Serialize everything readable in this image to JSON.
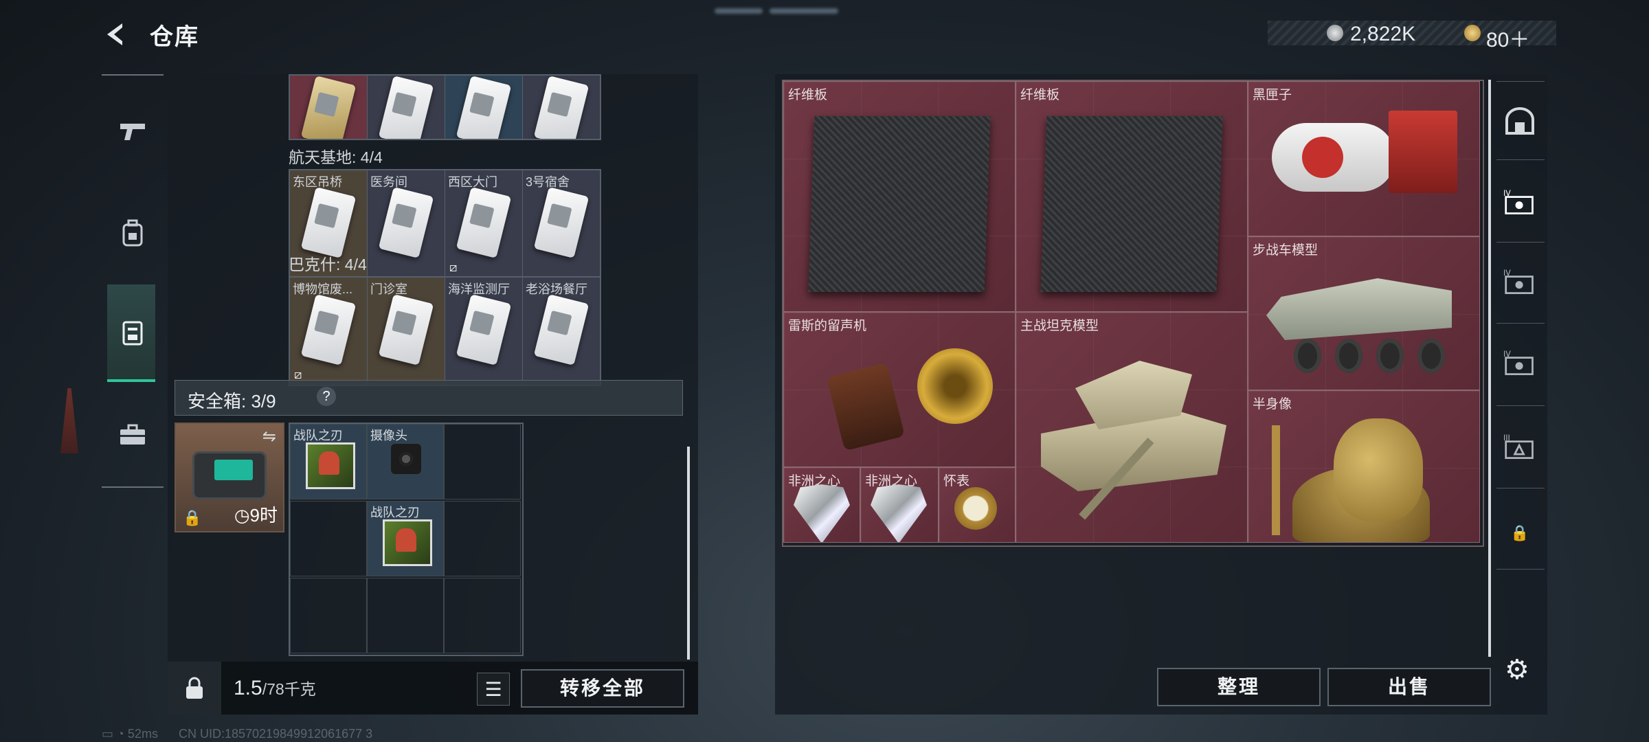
{
  "header": {
    "title": "仓库",
    "currency_1": "2,822K",
    "currency_2": "80＋"
  },
  "left_sidebar": {
    "icons": [
      "pistol-icon",
      "backpack-icon",
      "safe-box-icon",
      "toolbox-icon"
    ]
  },
  "storage": {
    "top_row": {
      "cards": [
        {
          "label": ""
        },
        {
          "label": ""
        },
        {
          "label": ""
        },
        {
          "label": ""
        }
      ]
    },
    "section_1": {
      "name": "航天基地: 4/4",
      "cards": [
        {
          "label": "东区吊桥"
        },
        {
          "label": "医务间"
        },
        {
          "label": "西区大门"
        },
        {
          "label": "3号宿舍"
        }
      ]
    },
    "section_2": {
      "name": "巴克什: 4/4",
      "cards": [
        {
          "label": "博物馆废..."
        },
        {
          "label": "门诊室"
        },
        {
          "label": "海洋监测厅"
        },
        {
          "label": "老浴场餐厅"
        }
      ]
    }
  },
  "safe_box": {
    "label": "安全箱: 3/9",
    "help": "?",
    "timer": "9时",
    "items": [
      {
        "label": "战队之刃"
      },
      {
        "label": "摄像头"
      },
      {
        "label": "战队之刃"
      }
    ]
  },
  "bottom": {
    "weight_value": "1.5",
    "weight_total": "/78千克",
    "transfer_all": "转移全部"
  },
  "inventory": {
    "items": [
      {
        "label": "纤维板"
      },
      {
        "label": "纤维板"
      },
      {
        "label": "黑匣子"
      },
      {
        "label": "步战车模型"
      },
      {
        "label": "雷斯的留声机"
      },
      {
        "label": "主战坦克模型"
      },
      {
        "label": "半身像"
      },
      {
        "label": "非洲之心"
      },
      {
        "label": "非洲之心"
      },
      {
        "label": "怀表"
      }
    ]
  },
  "actions": {
    "sort": "整理",
    "sell": "出售"
  },
  "status_bar": {
    "ping": "52ms",
    "uid": "CN UID:18570219849912061677 3"
  },
  "colors": {
    "accent": "#2ec69a",
    "item_bg": "#6a3340"
  }
}
